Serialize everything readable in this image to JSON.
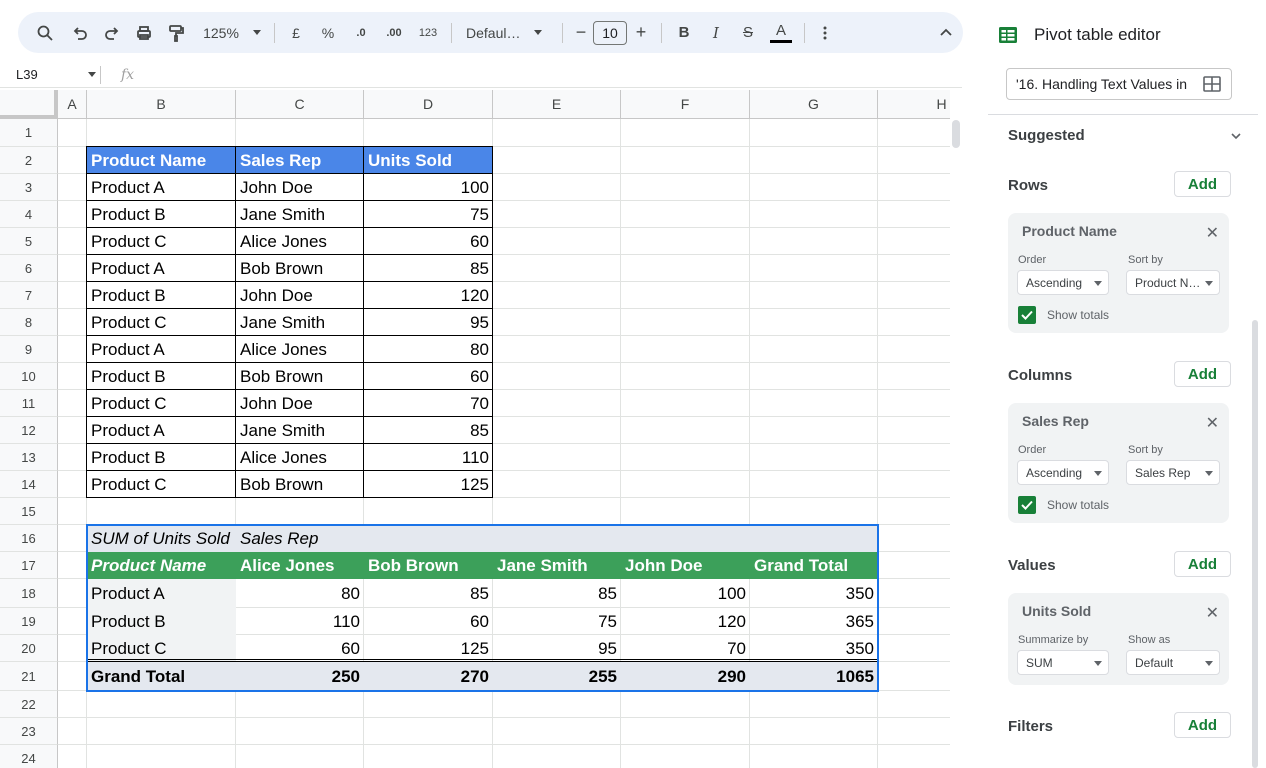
{
  "toolbar": {
    "zoom": "125%",
    "currency": "£",
    "percent": "%",
    "decrease_decimal": ".0",
    "increase_decimal": ".00",
    "number_format": "123",
    "font_family": "Defaul…",
    "font_size": "10",
    "bold": "B",
    "italic": "I",
    "strikethrough": "S",
    "text_color": "A",
    "minus": "−",
    "plus": "+"
  },
  "formula_bar": {
    "cell_ref": "L39",
    "fx": "fx"
  },
  "columns": [
    "A",
    "B",
    "C",
    "D",
    "E",
    "F",
    "G",
    "H"
  ],
  "rows": [
    "1",
    "2",
    "3",
    "4",
    "5",
    "6",
    "7",
    "8",
    "9",
    "10",
    "11",
    "12",
    "13",
    "14",
    "15",
    "16",
    "17",
    "18",
    "19",
    "20",
    "21",
    "22",
    "23",
    "24"
  ],
  "source_table": {
    "headers": [
      "Product Name",
      "Sales Rep",
      "Units Sold"
    ],
    "rows": [
      [
        "Product A",
        "John Doe",
        "100"
      ],
      [
        "Product B",
        "Jane Smith",
        "75"
      ],
      [
        "Product C",
        "Alice Jones",
        "60"
      ],
      [
        "Product A",
        "Bob Brown",
        "85"
      ],
      [
        "Product B",
        "John Doe",
        "120"
      ],
      [
        "Product C",
        "Jane Smith",
        "95"
      ],
      [
        "Product A",
        "Alice Jones",
        "80"
      ],
      [
        "Product B",
        "Bob Brown",
        "60"
      ],
      [
        "Product C",
        "John Doe",
        "70"
      ],
      [
        "Product A",
        "Jane Smith",
        "85"
      ],
      [
        "Product B",
        "Alice Jones",
        "110"
      ],
      [
        "Product C",
        "Bob Brown",
        "125"
      ]
    ]
  },
  "pivot_table": {
    "value_label": "SUM of Units Sold",
    "column_field": "Sales Rep",
    "row_field": "Product Name",
    "column_headers": [
      "Alice Jones",
      "Bob Brown",
      "Jane Smith",
      "John Doe",
      "Grand Total"
    ],
    "rows": [
      {
        "label": "Product A",
        "values": [
          "80",
          "85",
          "85",
          "100",
          "350"
        ]
      },
      {
        "label": "Product B",
        "values": [
          "110",
          "60",
          "75",
          "120",
          "365"
        ]
      },
      {
        "label": "Product C",
        "values": [
          "60",
          "125",
          "95",
          "70",
          "350"
        ]
      }
    ],
    "total": {
      "label": "Grand Total",
      "values": [
        "250",
        "270",
        "255",
        "290",
        "1065"
      ]
    }
  },
  "panel": {
    "title": "Pivot table editor",
    "range": "'16. Handling Text Values in",
    "suggested": "Suggested",
    "rows_title": "Rows",
    "columns_title": "Columns",
    "values_title": "Values",
    "filters_title": "Filters",
    "add_label": "Add",
    "rows_card": {
      "title": "Product Name",
      "order_label": "Order",
      "order_value": "Ascending",
      "sortby_label": "Sort by",
      "sortby_value": "Product N…",
      "show_totals": "Show totals"
    },
    "columns_card": {
      "title": "Sales Rep",
      "order_label": "Order",
      "order_value": "Ascending",
      "sortby_label": "Sort by",
      "sortby_value": "Sales Rep",
      "show_totals": "Show totals"
    },
    "values_card": {
      "title": "Units Sold",
      "summarize_label": "Summarize by",
      "summarize_value": "SUM",
      "showas_label": "Show as",
      "showas_value": "Default"
    }
  },
  "colors": {
    "source_header": "#4a86e8",
    "pivot_header": "#3ca05a",
    "add_text": "#188038",
    "selection": "#1a73e8"
  }
}
